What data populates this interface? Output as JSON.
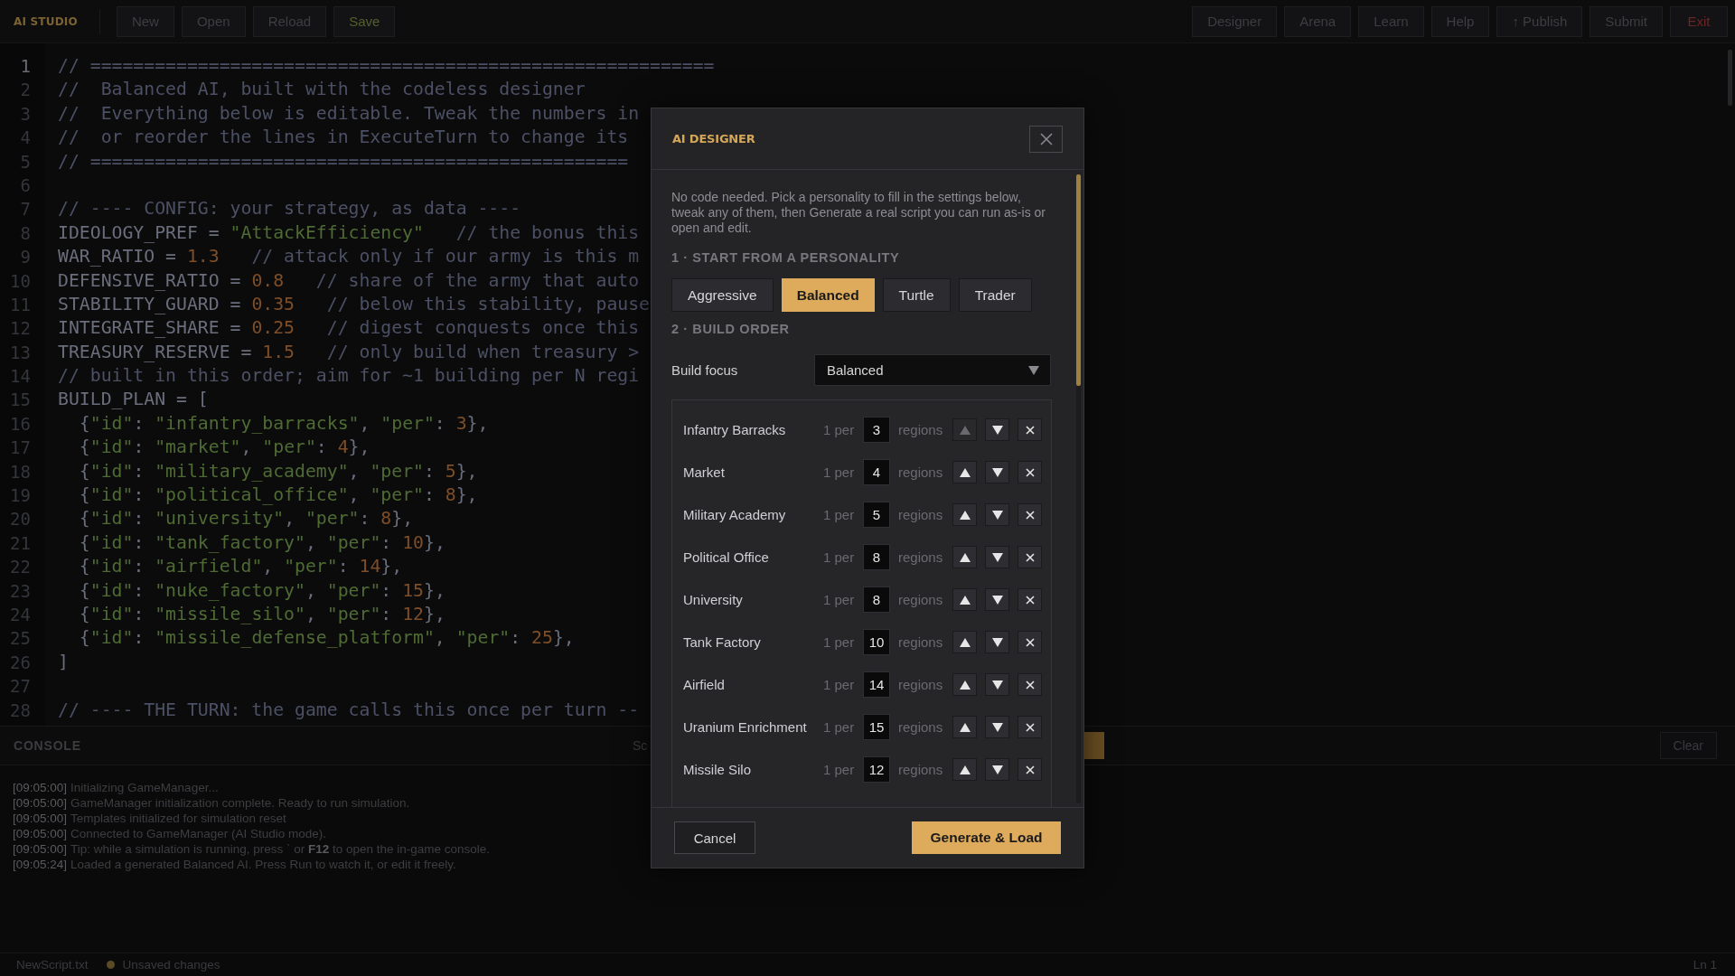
{
  "app_bar": {
    "logo": "AI STUDIO",
    "left_buttons": [
      {
        "label": "New",
        "kind": "default"
      },
      {
        "label": "Open",
        "kind": "default"
      },
      {
        "label": "Reload",
        "kind": "default"
      },
      {
        "label": "Save",
        "kind": "save"
      }
    ],
    "right_buttons": [
      {
        "label": "Designer",
        "kind": "default"
      },
      {
        "label": "Arena",
        "kind": "default"
      },
      {
        "label": "Learn",
        "kind": "default"
      },
      {
        "label": "Help",
        "kind": "default"
      },
      {
        "label": "↑ Publish",
        "kind": "default"
      },
      {
        "label": "Submit",
        "kind": "default"
      },
      {
        "label": "Exit",
        "kind": "exit"
      }
    ]
  },
  "editor": {
    "lines": [
      {
        "number": "1",
        "text": "// ==========================================================",
        "current": true
      },
      {
        "number": "2",
        "text": "//  Balanced AI, built with the codeless designer",
        "current": false
      },
      {
        "number": "3",
        "text": "//  Everything below is editable. Tweak the numbers in",
        "current": false
      },
      {
        "number": "4",
        "text": "//  or reorder the lines in ExecuteTurn to change its",
        "current": false
      },
      {
        "number": "5",
        "text": "// ==================================================",
        "current": false
      },
      {
        "number": "6",
        "current": false
      },
      {
        "number": "7",
        "text": "// ---- CONFIG: your strategy, as data ----",
        "current": false
      },
      {
        "number": "8",
        "text": "IDEOLOGY_PREF = \"AttackEfficiency\"   // the bonus this",
        "current": false
      },
      {
        "number": "9",
        "text": "WAR_RATIO = 1.3   // attack only if our army is this m",
        "current": false
      },
      {
        "number": "10",
        "text": "DEFENSIVE_RATIO = 0.8   // share of the army that auto",
        "current": false
      },
      {
        "number": "11",
        "text": "STABILITY_GUARD = 0.35   // below this stability, pause",
        "current": false
      },
      {
        "number": "12",
        "text": "INTEGRATE_SHARE = 0.25   // digest conquests once this",
        "current": false
      },
      {
        "number": "13",
        "text": "TREASURY_RESERVE = 1.5   // only build when treasury >",
        "current": false
      },
      {
        "number": "14",
        "text": "// built in this order; aim for ~1 building per N regi",
        "current": false
      },
      {
        "number": "15",
        "text": "BUILD_PLAN = [",
        "current": false
      },
      {
        "number": "16",
        "text": "  {\"id\": \"infantry_barracks\", \"per\": 3},",
        "current": false
      },
      {
        "number": "17",
        "text": "  {\"id\": \"market\", \"per\": 4},",
        "current": false
      },
      {
        "number": "18",
        "text": "  {\"id\": \"military_academy\", \"per\": 5},",
        "current": false
      },
      {
        "number": "19",
        "text": "  {\"id\": \"political_office\", \"per\": 8},",
        "current": false
      },
      {
        "number": "20",
        "text": "  {\"id\": \"university\", \"per\": 8},",
        "current": false
      },
      {
        "number": "21",
        "text": "  {\"id\": \"tank_factory\", \"per\": 10},",
        "current": false
      },
      {
        "number": "22",
        "text": "  {\"id\": \"airfield\", \"per\": 14},",
        "current": false
      },
      {
        "number": "23",
        "text": "  {\"id\": \"nuke_factory\", \"per\": 15},",
        "current": false
      },
      {
        "number": "24",
        "text": "  {\"id\": \"missile_silo\", \"per\": 12},",
        "current": false
      },
      {
        "number": "25",
        "text": "  {\"id\": \"missile_defense_platform\", \"per\": 25},",
        "current": false
      },
      {
        "number": "26",
        "text": "]",
        "current": false
      },
      {
        "number": "27",
        "current": false
      },
      {
        "number": "28",
        "text": "// ---- THE TURN: the game calls this once per turn --",
        "current": false
      }
    ]
  },
  "console": {
    "title": "CONSOLE",
    "tab_fragment": "Sc",
    "clear_button": "Clear",
    "logs": [
      {
        "time": "[09:05:00]",
        "message": "Initializing GameManager..."
      },
      {
        "time": "[09:05:00]",
        "message": "GameManager initialization complete. Ready to run simulation."
      },
      {
        "time": "[09:05:00]",
        "message": "Templates initialized for simulation reset"
      },
      {
        "time": "[09:05:00]",
        "message": "Connected to GameManager (AI Studio mode)."
      },
      {
        "time": "[09:05:00]",
        "message": "Tip: while a simulation is running, press ` or **F12** to open the in-game console."
      },
      {
        "time": "[09:05:24]",
        "message": "Loaded a generated Balanced AI. Press Run to watch it, or edit it freely."
      }
    ]
  },
  "status_bar": {
    "file": "NewScript.txt",
    "unsaved": true,
    "unsaved_label": "Unsaved changes",
    "position": "Ln 1"
  },
  "dialog": {
    "title": "AI DESIGNER",
    "intro": "No code needed. Pick a personality to fill in the settings below, tweak any of them, then Generate a real script you can run as-is or open and edit.",
    "personality_heading": "1 · START FROM A PERSONALITY",
    "personalities": [
      {
        "label": "Aggressive",
        "selected": false
      },
      {
        "label": "Balanced",
        "selected": true
      },
      {
        "label": "Turtle",
        "selected": false
      },
      {
        "label": "Trader",
        "selected": false
      }
    ],
    "build_heading": "2 · BUILD ORDER",
    "build_focus": {
      "label": "Build focus",
      "value": "Balanced"
    },
    "build_rows": [
      {
        "name": "Infantry Barracks",
        "prefix": "1 per",
        "value": "3",
        "unit": "regions",
        "up_disabled": true
      },
      {
        "name": "Market",
        "prefix": "1 per",
        "value": "4",
        "unit": "regions",
        "up_disabled": false
      },
      {
        "name": "Military Academy",
        "prefix": "1 per",
        "value": "5",
        "unit": "regions",
        "up_disabled": false
      },
      {
        "name": "Political Office",
        "prefix": "1 per",
        "value": "8",
        "unit": "regions",
        "up_disabled": false
      },
      {
        "name": "University",
        "prefix": "1 per",
        "value": "8",
        "unit": "regions",
        "up_disabled": false
      },
      {
        "name": "Tank Factory",
        "prefix": "1 per",
        "value": "10",
        "unit": "regions",
        "up_disabled": false
      },
      {
        "name": "Airfield",
        "prefix": "1 per",
        "value": "14",
        "unit": "regions",
        "up_disabled": false
      },
      {
        "name": "Uranium Enrichment",
        "prefix": "1 per",
        "value": "15",
        "unit": "regions",
        "up_disabled": false
      },
      {
        "name": "Missile Silo",
        "prefix": "1 per",
        "value": "12",
        "unit": "regions",
        "up_disabled": false
      }
    ],
    "cancel_button": "Cancel",
    "generate_button": "Generate & Load"
  }
}
